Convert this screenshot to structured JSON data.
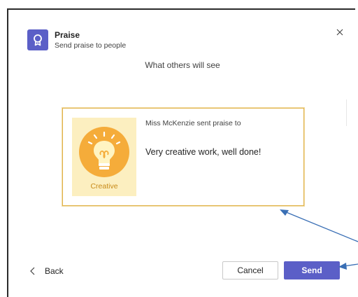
{
  "dialog": {
    "title": "Praise",
    "subtitle": "Send praise to people",
    "close_icon": "close-icon",
    "app_icon": "award-ribbon-icon"
  },
  "preview": {
    "heading": "What others will see",
    "sender_text": "Miss McKenzie sent praise to",
    "message": "Very creative work, well done!",
    "badge": {
      "label": "Creative",
      "icon": "lightbulb-icon",
      "colors": {
        "background": "#fcefc0",
        "circle": "#f5ac3a",
        "label": "#c88a18"
      }
    },
    "card_border_color": "#e0b24a"
  },
  "footer": {
    "back_label": "Back",
    "cancel_label": "Cancel",
    "send_label": "Send"
  },
  "colors": {
    "accent": "#5b5fc7",
    "annotation_arrow": "#3a6fb5"
  }
}
